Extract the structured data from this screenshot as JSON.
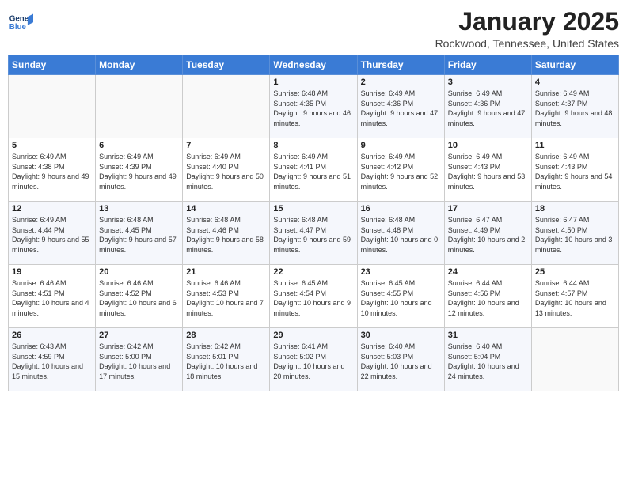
{
  "header": {
    "logo_line1": "General",
    "logo_line2": "Blue",
    "month": "January 2025",
    "location": "Rockwood, Tennessee, United States"
  },
  "weekdays": [
    "Sunday",
    "Monday",
    "Tuesday",
    "Wednesday",
    "Thursday",
    "Friday",
    "Saturday"
  ],
  "weeks": [
    [
      {
        "day": "",
        "info": ""
      },
      {
        "day": "",
        "info": ""
      },
      {
        "day": "",
        "info": ""
      },
      {
        "day": "1",
        "info": "Sunrise: 6:48 AM\nSunset: 4:35 PM\nDaylight: 9 hours and 46 minutes."
      },
      {
        "day": "2",
        "info": "Sunrise: 6:49 AM\nSunset: 4:36 PM\nDaylight: 9 hours and 47 minutes."
      },
      {
        "day": "3",
        "info": "Sunrise: 6:49 AM\nSunset: 4:36 PM\nDaylight: 9 hours and 47 minutes."
      },
      {
        "day": "4",
        "info": "Sunrise: 6:49 AM\nSunset: 4:37 PM\nDaylight: 9 hours and 48 minutes."
      }
    ],
    [
      {
        "day": "5",
        "info": "Sunrise: 6:49 AM\nSunset: 4:38 PM\nDaylight: 9 hours and 49 minutes."
      },
      {
        "day": "6",
        "info": "Sunrise: 6:49 AM\nSunset: 4:39 PM\nDaylight: 9 hours and 49 minutes."
      },
      {
        "day": "7",
        "info": "Sunrise: 6:49 AM\nSunset: 4:40 PM\nDaylight: 9 hours and 50 minutes."
      },
      {
        "day": "8",
        "info": "Sunrise: 6:49 AM\nSunset: 4:41 PM\nDaylight: 9 hours and 51 minutes."
      },
      {
        "day": "9",
        "info": "Sunrise: 6:49 AM\nSunset: 4:42 PM\nDaylight: 9 hours and 52 minutes."
      },
      {
        "day": "10",
        "info": "Sunrise: 6:49 AM\nSunset: 4:43 PM\nDaylight: 9 hours and 53 minutes."
      },
      {
        "day": "11",
        "info": "Sunrise: 6:49 AM\nSunset: 4:43 PM\nDaylight: 9 hours and 54 minutes."
      }
    ],
    [
      {
        "day": "12",
        "info": "Sunrise: 6:49 AM\nSunset: 4:44 PM\nDaylight: 9 hours and 55 minutes."
      },
      {
        "day": "13",
        "info": "Sunrise: 6:48 AM\nSunset: 4:45 PM\nDaylight: 9 hours and 57 minutes."
      },
      {
        "day": "14",
        "info": "Sunrise: 6:48 AM\nSunset: 4:46 PM\nDaylight: 9 hours and 58 minutes."
      },
      {
        "day": "15",
        "info": "Sunrise: 6:48 AM\nSunset: 4:47 PM\nDaylight: 9 hours and 59 minutes."
      },
      {
        "day": "16",
        "info": "Sunrise: 6:48 AM\nSunset: 4:48 PM\nDaylight: 10 hours and 0 minutes."
      },
      {
        "day": "17",
        "info": "Sunrise: 6:47 AM\nSunset: 4:49 PM\nDaylight: 10 hours and 2 minutes."
      },
      {
        "day": "18",
        "info": "Sunrise: 6:47 AM\nSunset: 4:50 PM\nDaylight: 10 hours and 3 minutes."
      }
    ],
    [
      {
        "day": "19",
        "info": "Sunrise: 6:46 AM\nSunset: 4:51 PM\nDaylight: 10 hours and 4 minutes."
      },
      {
        "day": "20",
        "info": "Sunrise: 6:46 AM\nSunset: 4:52 PM\nDaylight: 10 hours and 6 minutes."
      },
      {
        "day": "21",
        "info": "Sunrise: 6:46 AM\nSunset: 4:53 PM\nDaylight: 10 hours and 7 minutes."
      },
      {
        "day": "22",
        "info": "Sunrise: 6:45 AM\nSunset: 4:54 PM\nDaylight: 10 hours and 9 minutes."
      },
      {
        "day": "23",
        "info": "Sunrise: 6:45 AM\nSunset: 4:55 PM\nDaylight: 10 hours and 10 minutes."
      },
      {
        "day": "24",
        "info": "Sunrise: 6:44 AM\nSunset: 4:56 PM\nDaylight: 10 hours and 12 minutes."
      },
      {
        "day": "25",
        "info": "Sunrise: 6:44 AM\nSunset: 4:57 PM\nDaylight: 10 hours and 13 minutes."
      }
    ],
    [
      {
        "day": "26",
        "info": "Sunrise: 6:43 AM\nSunset: 4:59 PM\nDaylight: 10 hours and 15 minutes."
      },
      {
        "day": "27",
        "info": "Sunrise: 6:42 AM\nSunset: 5:00 PM\nDaylight: 10 hours and 17 minutes."
      },
      {
        "day": "28",
        "info": "Sunrise: 6:42 AM\nSunset: 5:01 PM\nDaylight: 10 hours and 18 minutes."
      },
      {
        "day": "29",
        "info": "Sunrise: 6:41 AM\nSunset: 5:02 PM\nDaylight: 10 hours and 20 minutes."
      },
      {
        "day": "30",
        "info": "Sunrise: 6:40 AM\nSunset: 5:03 PM\nDaylight: 10 hours and 22 minutes."
      },
      {
        "day": "31",
        "info": "Sunrise: 6:40 AM\nSunset: 5:04 PM\nDaylight: 10 hours and 24 minutes."
      },
      {
        "day": "",
        "info": ""
      }
    ]
  ]
}
